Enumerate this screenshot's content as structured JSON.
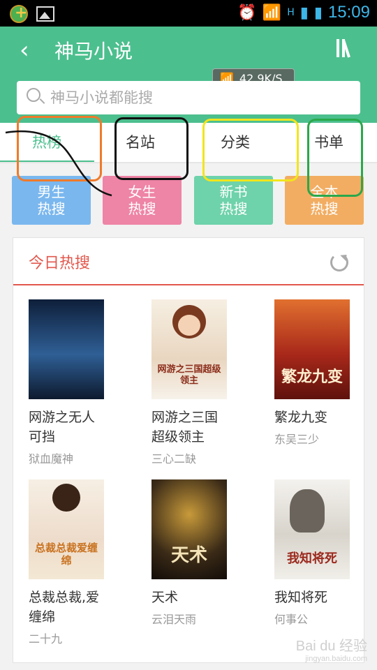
{
  "status_bar": {
    "time": "15:09",
    "network": "H"
  },
  "header": {
    "title": "神马小说",
    "speed": "42.9K/S"
  },
  "search": {
    "placeholder": "神马小说都能搜"
  },
  "tabs": [
    {
      "label": "热榜",
      "active": true
    },
    {
      "label": "名站",
      "active": false
    },
    {
      "label": "分类",
      "active": false
    },
    {
      "label": "书单",
      "active": false
    }
  ],
  "categories": [
    {
      "line1": "男生",
      "line2": "热搜",
      "color": "#7ab7ee"
    },
    {
      "line1": "女生",
      "line2": "热搜",
      "color": "#ee84a6"
    },
    {
      "line1": "新书",
      "line2": "热搜",
      "color": "#6ed2aa"
    },
    {
      "line1": "全本",
      "line2": "热搜",
      "color": "#f2ad62"
    }
  ],
  "section": {
    "title": "今日热搜"
  },
  "books": [
    {
      "title": "网游之无人可挡",
      "author": "狱血魔神",
      "cover_text": "",
      "cover_color": "#1b3f6e"
    },
    {
      "title": "网游之三国超级领主",
      "author": "三心二缺",
      "cover_text": "网游之三国超级领主",
      "cover_color": "#f3ede4"
    },
    {
      "title": "繁龙九变",
      "author": "东吴三少",
      "cover_text": "繁龙九变",
      "cover_color": "#b8331f"
    },
    {
      "title": "总裁总裁,爱缠绵",
      "author": "二十九",
      "cover_text": "总裁总裁爱缠绵",
      "cover_color": "#f4e8d8"
    },
    {
      "title": "天术",
      "author": "云泪天雨",
      "cover_text": "天术",
      "cover_color": "#2a2118"
    },
    {
      "title": "我知将死",
      "author": "何事公",
      "cover_text": "我知将死",
      "cover_color": "#eceae4"
    }
  ],
  "watermark": {
    "text": "Bai du 经验",
    "sub": "jingyan.baidu.com"
  },
  "colors": {
    "accent": "#4cbf8e",
    "section_red": "#e2574c"
  }
}
